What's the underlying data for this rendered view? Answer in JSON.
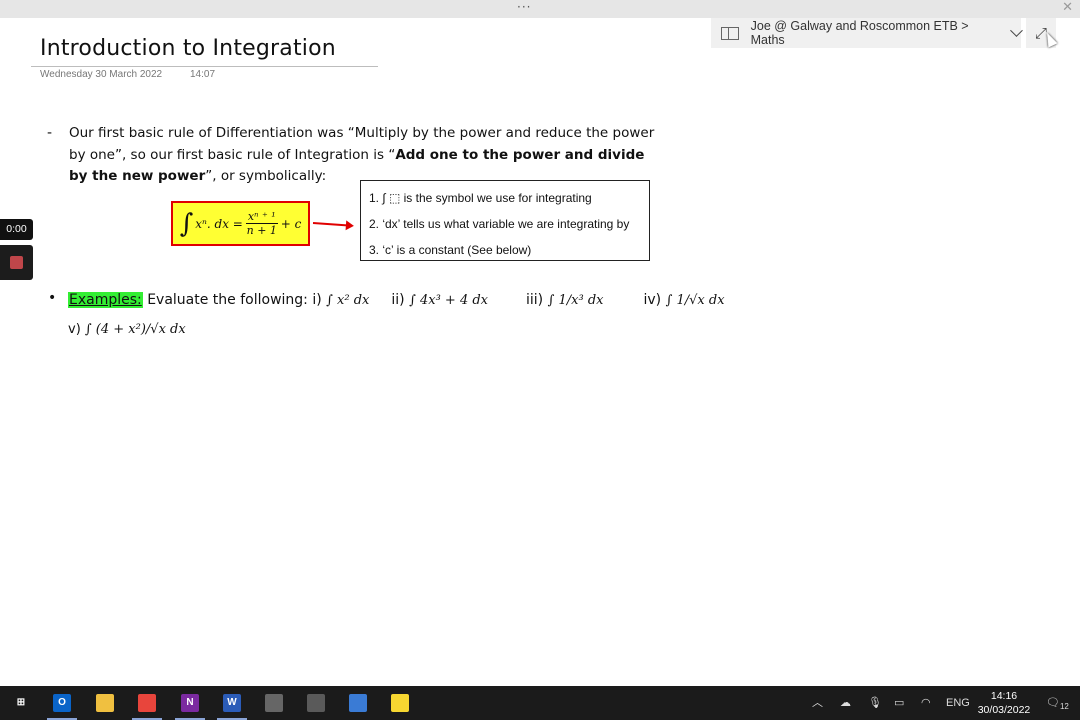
{
  "window": {
    "grip": "···",
    "close": "✕",
    "notebook_label": "Joe @ Galway and Roscommon ETB > Maths",
    "expand": "⤢"
  },
  "page": {
    "title": "Introduction to Integration",
    "date": "Wednesday 30 March 2022",
    "time": "14:07"
  },
  "content": {
    "dash": "-",
    "para_part1": "Our first basic rule of Differentiation was “Multiply by the power and reduce the power by one”, so our first basic rule of Integration is “",
    "para_bold": "Add one to the power and divide by the new power",
    "para_part2": "”, or symbolically:",
    "formula_lhs": "xⁿ. dx =",
    "formula_num": "xⁿ ⁺ ¹",
    "formula_den": "n + 1",
    "formula_rhs": "+ c",
    "info": [
      "1. ∫ ⬚ is the symbol we use for integrating",
      "2. ‘dx’ tells us what variable we are integrating by",
      "3. ‘c’ is a constant (See below)"
    ],
    "bullet": "•",
    "examples_word": "Examples:",
    "examples_intro": " Evaluate the following: i) ",
    "ex1": "∫ x² dx",
    "ex2_label": "ii) ",
    "ex2": "∫ 4x³ + 4 dx",
    "ex3_label": "iii) ",
    "ex3": "∫ 1/x³ dx",
    "ex4_label": "iv) ",
    "ex4": "∫ 1/√x dx",
    "ex5_label": "v) ",
    "ex5": "∫ (4 + x²)/√x dx"
  },
  "recorder": {
    "timer": "0:00"
  },
  "taskbar": {
    "icons": [
      {
        "name": "windows-start-icon",
        "glyph": "⊞",
        "color": "#ffffff"
      },
      {
        "name": "outlook-icon",
        "glyph": "O",
        "color": "#0a64c8"
      },
      {
        "name": "file-explorer-icon",
        "glyph": "",
        "color": "#f0c040"
      },
      {
        "name": "chrome-icon",
        "glyph": "",
        "color": "#e8453c"
      },
      {
        "name": "onenote-icon",
        "glyph": "N",
        "color": "#7b2aa0"
      },
      {
        "name": "word-icon",
        "glyph": "W",
        "color": "#2b5cb8"
      },
      {
        "name": "phone-icon",
        "glyph": "",
        "color": "#666666"
      },
      {
        "name": "calculator-icon",
        "glyph": "",
        "color": "#5a5a5a"
      },
      {
        "name": "app-icon",
        "glyph": "",
        "color": "#3a7bd5"
      },
      {
        "name": "sticky-notes-icon",
        "glyph": "",
        "color": "#f7d731"
      }
    ],
    "tray_lang": "ENG",
    "clock_time": "14:16",
    "clock_date": "30/03/2022",
    "notifications": "12"
  }
}
